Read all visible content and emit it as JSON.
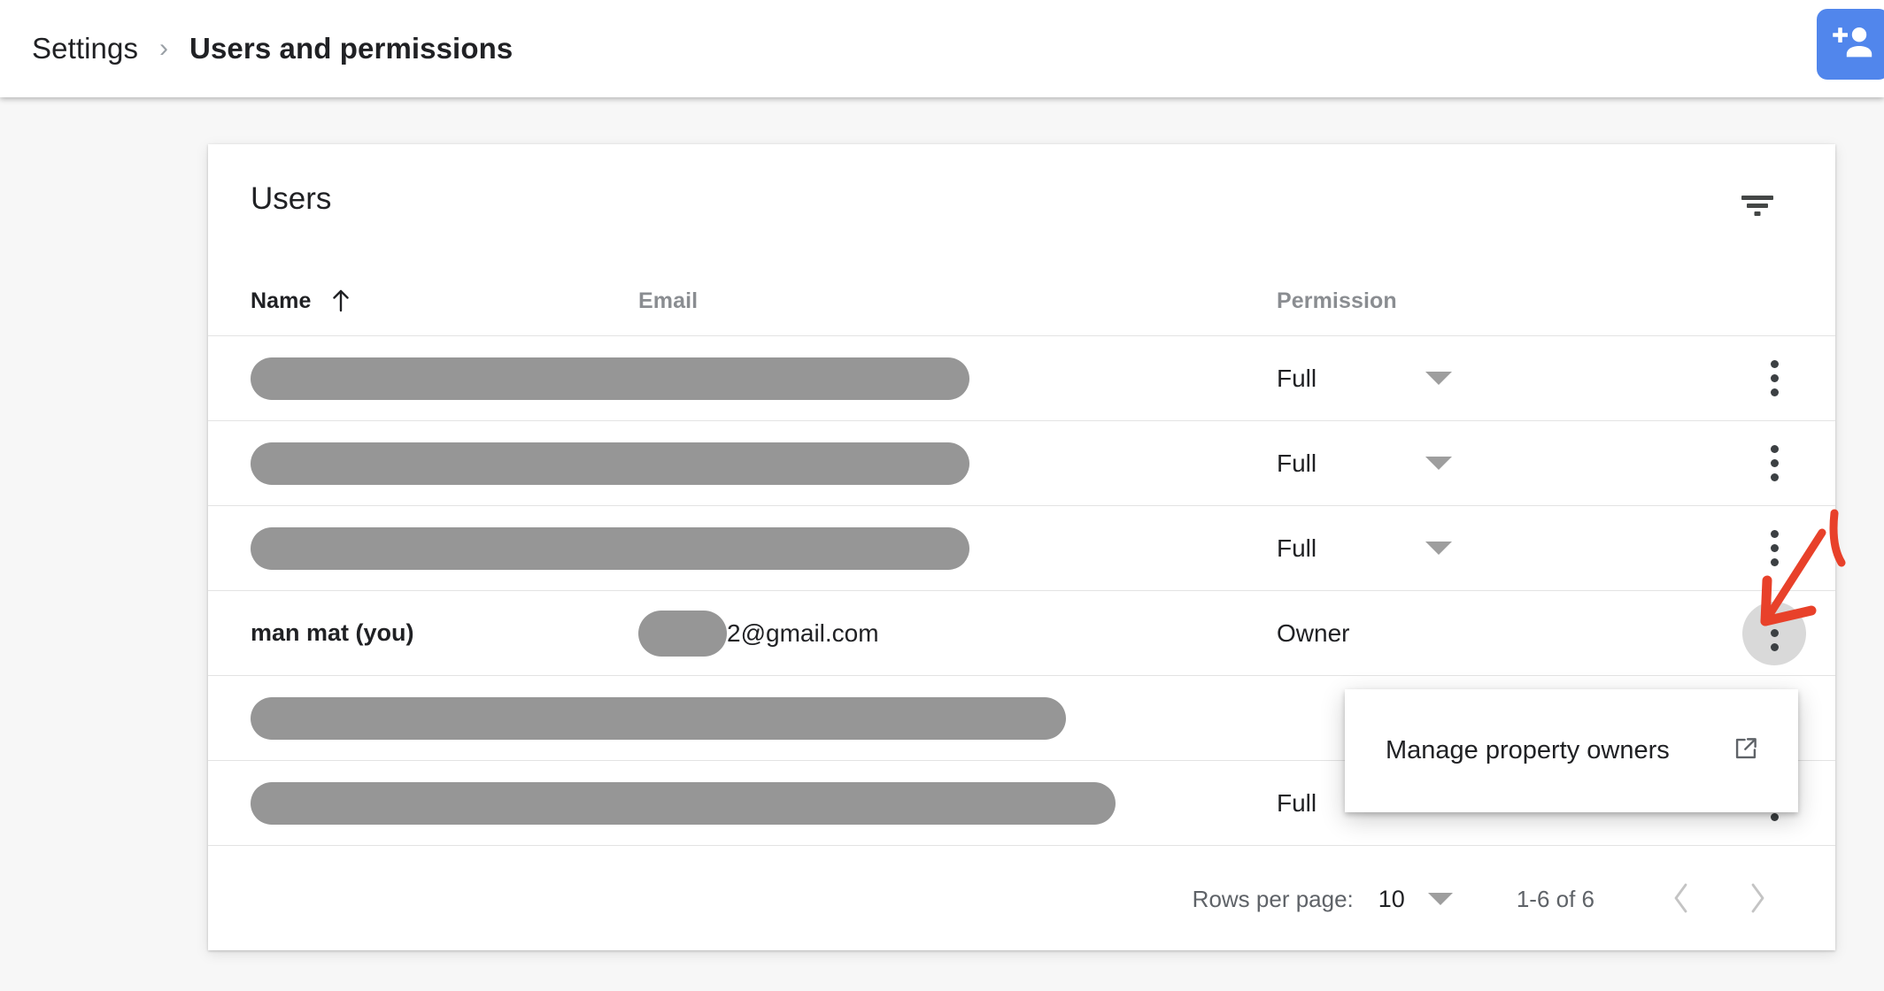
{
  "header": {
    "breadcrumb_root": "Settings",
    "breadcrumb_separator": "›",
    "breadcrumb_current": "Users and permissions",
    "add_user_icon": "person-add-icon",
    "accent_color": "#5186ec"
  },
  "card": {
    "title": "Users",
    "filter_icon": "filter-list-icon"
  },
  "table": {
    "columns": [
      {
        "label": "Name",
        "sorted": true,
        "sort_direction": "asc"
      },
      {
        "label": "Email",
        "sorted": false
      },
      {
        "label": "Permission",
        "sorted": false
      }
    ],
    "rows": [
      {
        "name": "",
        "name_redacted": true,
        "name_mask_width": 812,
        "email": "",
        "email_redacted": false,
        "permission": "Full",
        "has_permission_caret": true,
        "kebab_active": false
      },
      {
        "name": "",
        "name_redacted": true,
        "name_mask_width": 812,
        "email": "",
        "email_redacted": false,
        "permission": "Full",
        "has_permission_caret": true,
        "kebab_active": false
      },
      {
        "name": "",
        "name_redacted": true,
        "name_mask_width": 812,
        "email": "",
        "email_redacted": false,
        "permission": "Full",
        "has_permission_caret": true,
        "kebab_active": false
      },
      {
        "name": "man mat (you)",
        "name_redacted": false,
        "email": "2@gmail.com",
        "email_redacted": true,
        "permission": "Owner",
        "has_permission_caret": false,
        "kebab_active": true
      },
      {
        "name": "",
        "name_redacted": true,
        "name_mask_width": 921,
        "email": "",
        "email_redacted": false,
        "permission": "",
        "has_permission_caret": false,
        "kebab_active": false
      },
      {
        "name": "",
        "name_redacted": true,
        "name_mask_width": 977,
        "email": "",
        "email_redacted": false,
        "permission": "Full",
        "has_permission_caret": true,
        "kebab_active": false
      }
    ]
  },
  "menu": {
    "items": [
      {
        "label": "Manage property owners",
        "trailing_icon": "open-in-new-icon"
      }
    ]
  },
  "paginator": {
    "rows_per_page_label": "Rows per page:",
    "rows_per_page_value": "10",
    "range_label": "1-6 of 6",
    "prev_icon": "chevron-left-icon",
    "next_icon": "chevron-right-icon"
  },
  "annotation": {
    "color": "#e8412a",
    "type": "arrow",
    "points_to": "kebab-menu-button-row-4"
  }
}
